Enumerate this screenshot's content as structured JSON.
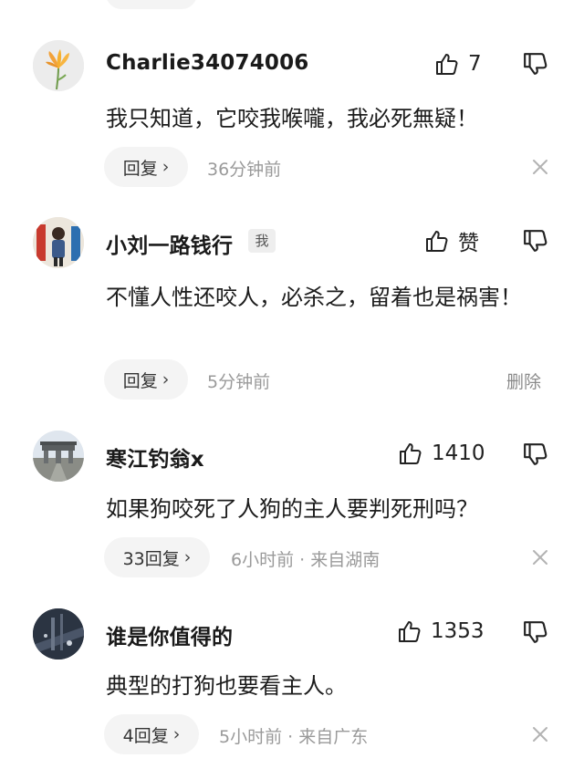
{
  "comments": [
    {
      "username": "Charlie34074006",
      "likes": "7",
      "text": "我只知道，它咬我喉嚨，我必死無疑！",
      "reply_label": "回复",
      "time": "36分钟前",
      "action": "close"
    },
    {
      "username": "小刘一路钱行",
      "badge": "我",
      "likes": "赞",
      "text": "不懂人性还咬人，必杀之，留着也是祸害！",
      "reply_label": "回复",
      "time": "5分钟前",
      "action": "delete",
      "delete_label": "删除"
    },
    {
      "username": "寒江钓翁x",
      "likes": "1410",
      "text": "如果狗咬死了人狗的主人要判死刑吗？",
      "reply_label": "33回复",
      "time": "6小时前 · 来自湖南",
      "action": "close"
    },
    {
      "username": "谁是你值得的",
      "likes": "1353",
      "text": "典型的打狗也要看主人。",
      "reply_label": "4回复",
      "time": "5小时前 · 来自广东",
      "action": "close"
    }
  ],
  "icons": {
    "like": "thumbs-up-icon",
    "dislike": "thumbs-down-icon",
    "close": "close-icon",
    "chevron": "chevron-right-icon"
  },
  "colors": {
    "text": "#1c1c1c",
    "meta": "#9a9a9a",
    "pill_bg": "#f4f4f4"
  }
}
